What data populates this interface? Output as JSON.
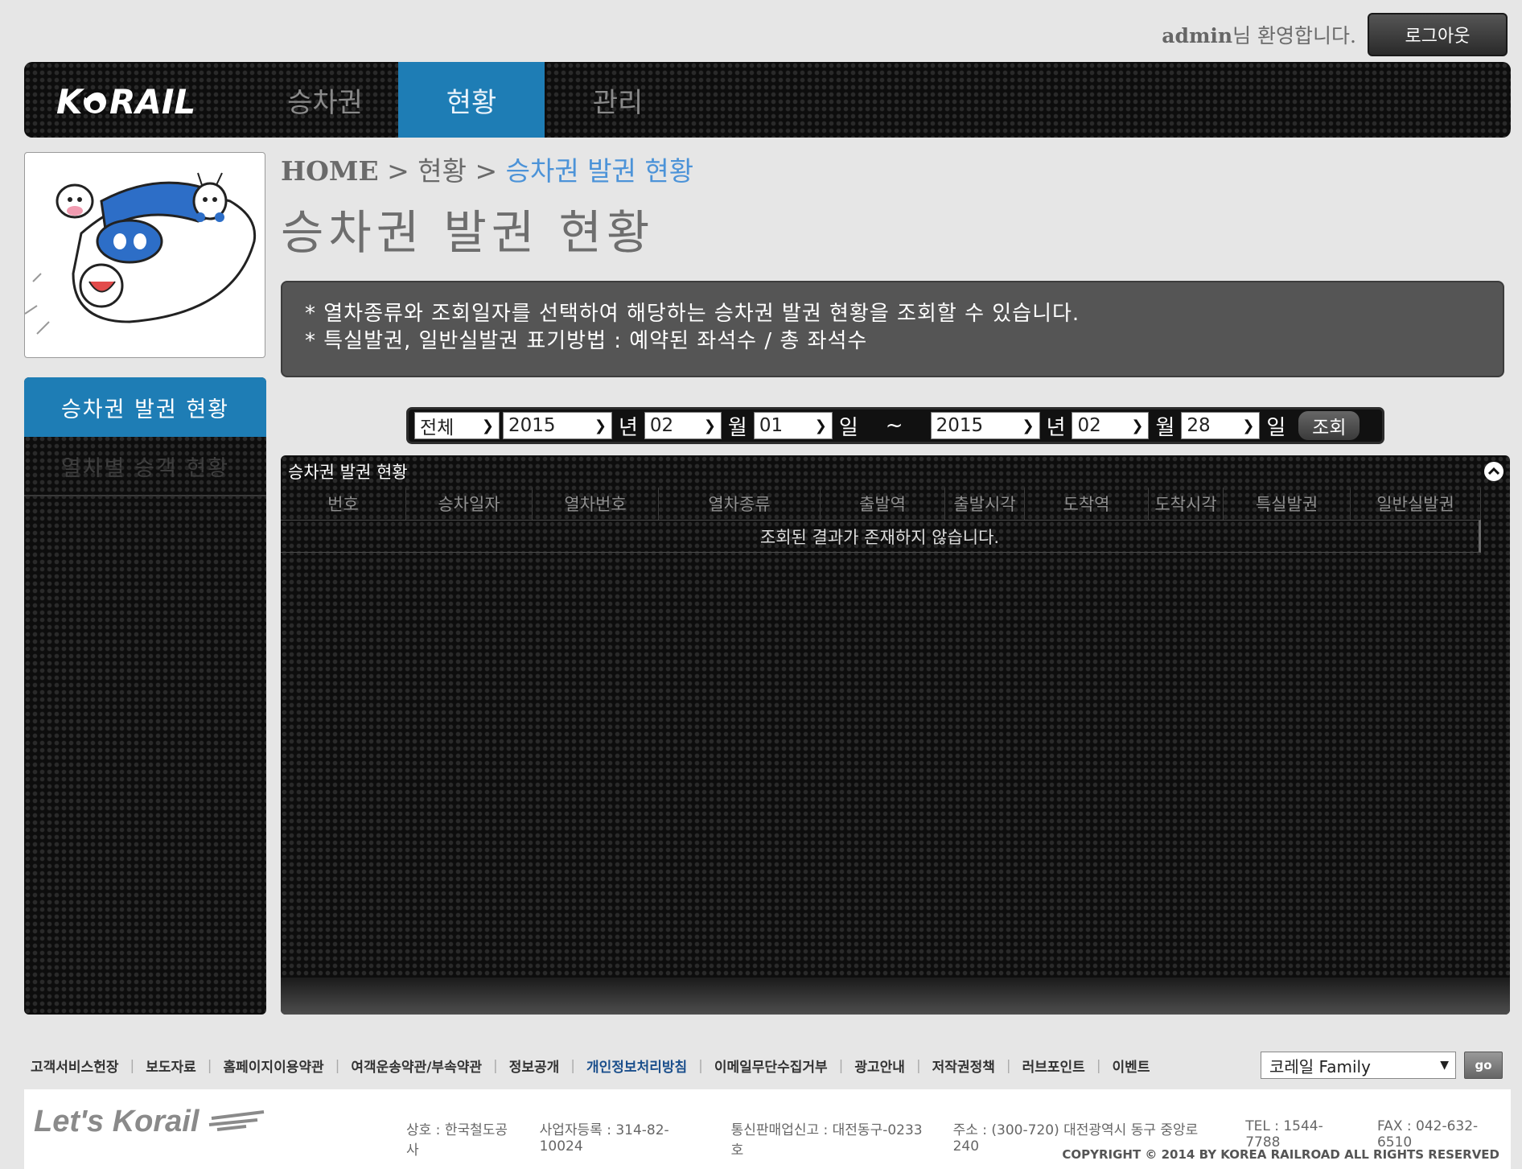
{
  "user": {
    "name": "admin",
    "welcome_suffix": "님 환영합니다.",
    "logout_label": "로그아웃"
  },
  "header": {
    "brand": "KORAIL",
    "nav": [
      {
        "label": "승차권",
        "active": false
      },
      {
        "label": "현황",
        "active": true
      },
      {
        "label": "관리",
        "active": false
      }
    ]
  },
  "sidebar": {
    "items": [
      {
        "label": "승차권 발권 현황",
        "active": true
      },
      {
        "label": "열차별 승객 현황",
        "active": false
      }
    ]
  },
  "breadcrumb": {
    "home": "HOME",
    "sep1": " > ",
    "section": "현황",
    "sep2": " > ",
    "current": "승차권 발권 현황"
  },
  "page_title": "승차권 발권 현황",
  "notice": {
    "line1": "* 열차종류와 조회일자를 선택하여 해당하는 승차권 발권 현황을 조회할 수 있습니다.",
    "line2": "* 특실발권, 일반실발권 표기방법 : 예약된 좌석수 / 총 좌석수"
  },
  "filter": {
    "train_type": "전체",
    "start_year": "2015",
    "start_month": "02",
    "start_day": "01",
    "end_year": "2015",
    "end_month": "02",
    "end_day": "28",
    "year_unit": "년",
    "month_unit": "월",
    "day_unit": "일",
    "range_sep": "~",
    "query_label": "조회"
  },
  "grid": {
    "caption": "승차권 발권 현황",
    "columns": [
      "번호",
      "승차일자",
      "열차번호",
      "열차종류",
      "출발역",
      "출발시각",
      "도착역",
      "도착시각",
      "특실발권",
      "일반실발권"
    ],
    "empty_message": "조회된 결과가 존재하지 않습니다."
  },
  "footer": {
    "links": [
      {
        "label": "고객서비스헌장",
        "highlight": false
      },
      {
        "label": "보도자료",
        "highlight": false
      },
      {
        "label": "홈페이지이용약관",
        "highlight": false
      },
      {
        "label": "여객운송약관/부속약관",
        "highlight": false
      },
      {
        "label": "정보공개",
        "highlight": false
      },
      {
        "label": "개인정보처리방침",
        "highlight": true
      },
      {
        "label": "이메일무단수집거부",
        "highlight": false
      },
      {
        "label": "광고안내",
        "highlight": false
      },
      {
        "label": "저작권정책",
        "highlight": false
      },
      {
        "label": "러브포인트",
        "highlight": false
      },
      {
        "label": "이벤트",
        "highlight": false
      }
    ],
    "family_select": "코레일 Family",
    "go_label": "go",
    "logo_text": "Let's Korail",
    "company": "상호 : 한국철도공사",
    "business_no": "사업자등록 : 314-82-10024",
    "mail_order": "통신판매업신고 : 대전동구-0233호",
    "address": "주소 : (300-720) 대전광역시 동구 중앙로 240",
    "tel": "TEL : 1544-7788",
    "fax": "FAX : 042-632-6510",
    "copyright": "COPYRIGHT © 2014 BY KOREA RAILROAD  ALL RIGHTS RESERVED"
  },
  "colors": {
    "accent": "#1e7db5",
    "breadcrumb_current": "#4c93d8",
    "background": "#e6e6e6"
  }
}
